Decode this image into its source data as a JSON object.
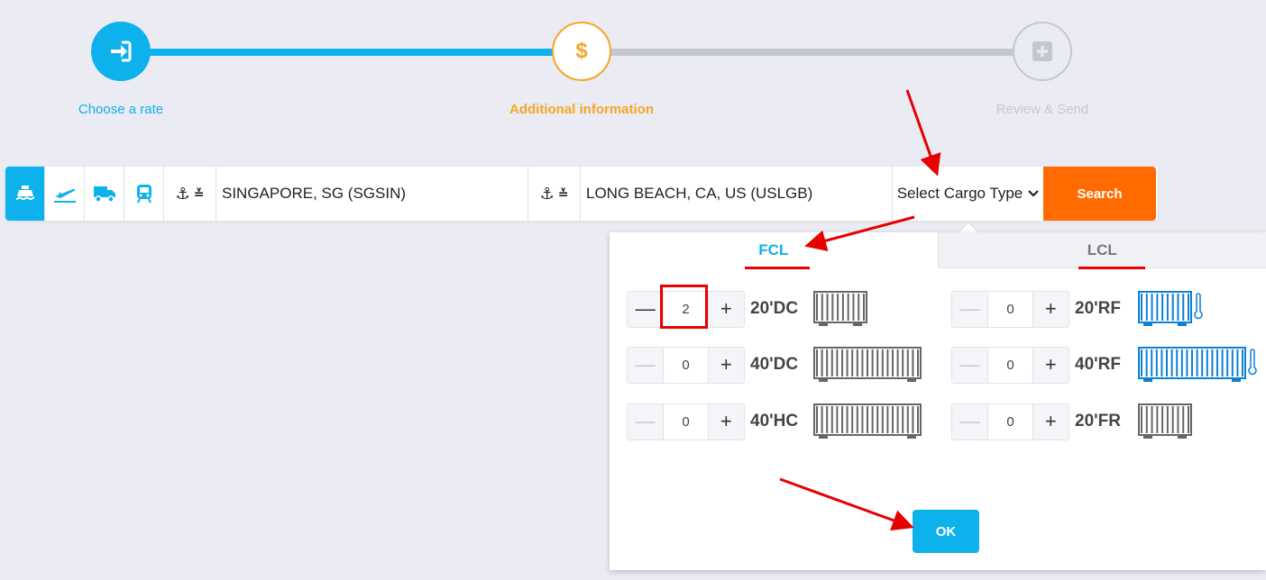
{
  "stepper": {
    "steps": [
      {
        "label": "Choose a rate",
        "icon": "sign-in-icon",
        "state": "done"
      },
      {
        "label": "Additional information",
        "icon": "dollar-icon",
        "state": "current",
        "symbol": "$"
      },
      {
        "label": "Review & Send",
        "icon": "plus-square-icon",
        "state": "pending"
      }
    ]
  },
  "search": {
    "modes": [
      "ship-icon",
      "plane-icon",
      "truck-icon",
      "train-icon"
    ],
    "active_mode": "ship-icon",
    "origin": "SINGAPORE, SG (SGSIN)",
    "destination": "LONG BEACH, CA, US (USLGB)",
    "cargo_type_placeholder": "Select Cargo Type",
    "search_label": "Search"
  },
  "cargo_panel": {
    "tabs": [
      {
        "label": "FCL",
        "active": true
      },
      {
        "label": "LCL",
        "active": false
      }
    ],
    "containers": [
      {
        "type": "20'DC",
        "qty": "2",
        "reefer": false
      },
      {
        "type": "40'DC",
        "qty": "0",
        "reefer": false
      },
      {
        "type": "40'HC",
        "qty": "0",
        "reefer": false
      },
      {
        "type": "20'RF",
        "qty": "0",
        "reefer": true
      },
      {
        "type": "40'RF",
        "qty": "0",
        "reefer": true
      },
      {
        "type": "20'FR",
        "qty": "0",
        "reefer": false
      }
    ],
    "minus_symbol": "—",
    "plus_symbol": "+",
    "ok_label": "OK"
  },
  "colors": {
    "accent": "#0db1ec",
    "orange": "#ff6b00",
    "current_step": "#f5a623",
    "annotation_red": "#e60000"
  }
}
